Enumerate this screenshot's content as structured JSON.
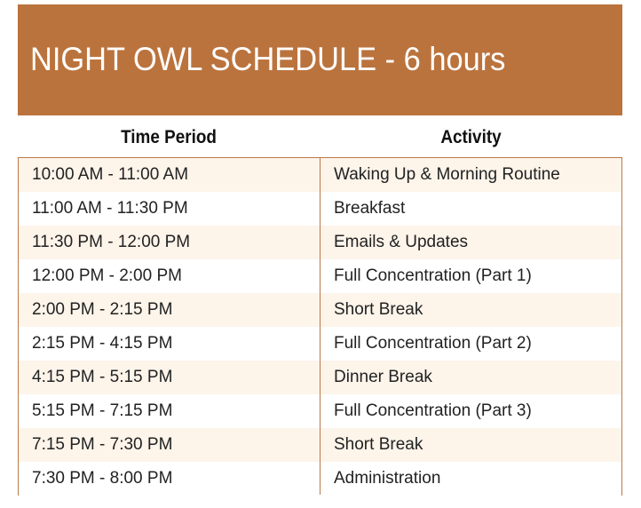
{
  "title": "NIGHT OWL SCHEDULE - 6 hours",
  "colors": {
    "banner": "#bb733d",
    "row_alt": "#fdf4ea",
    "border": "#b97a4a"
  },
  "table": {
    "headers": [
      "Time Period",
      "Activity"
    ],
    "rows": [
      {
        "time": "10:00 AM - 11:00 AM",
        "activity": "Waking Up & Morning Routine"
      },
      {
        "time": "11:00 AM - 11:30 PM",
        "activity": "Breakfast"
      },
      {
        "time": "11:30 PM - 12:00 PM",
        "activity": "Emails & Updates"
      },
      {
        "time": "12:00 PM - 2:00 PM",
        "activity": "Full Concentration (Part 1)"
      },
      {
        "time": "2:00 PM - 2:15 PM",
        "activity": "Short Break"
      },
      {
        "time": "2:15 PM - 4:15 PM",
        "activity": "Full Concentration (Part 2)"
      },
      {
        "time": "4:15 PM - 5:15 PM",
        "activity": "Dinner Break"
      },
      {
        "time": "5:15 PM - 7:15 PM",
        "activity": "Full Concentration (Part 3)"
      },
      {
        "time": "7:15 PM - 7:30 PM",
        "activity": "Short Break"
      },
      {
        "time": "7:30 PM - 8:00 PM",
        "activity": "Administration"
      }
    ]
  }
}
